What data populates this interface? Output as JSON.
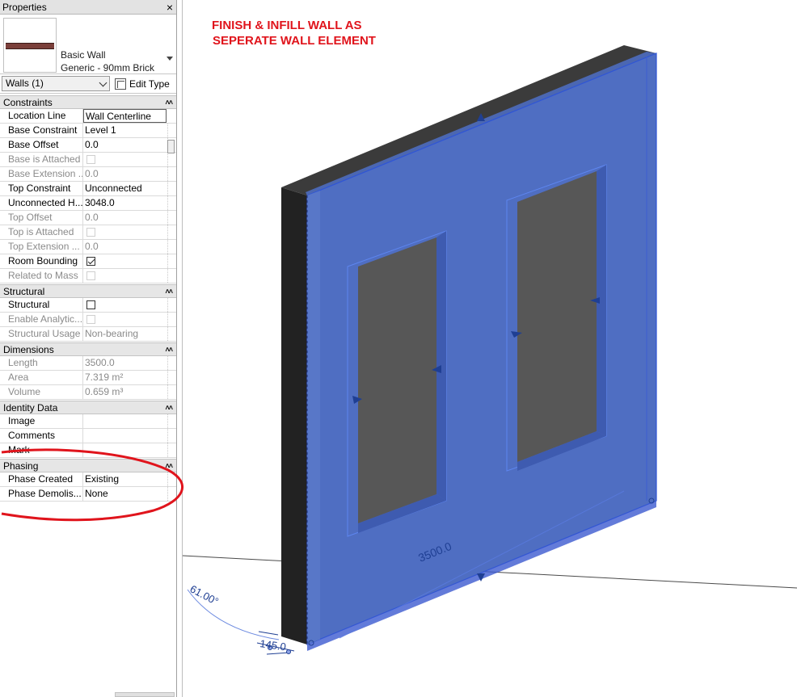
{
  "palette": {
    "title": "Properties",
    "close_glyph": "×",
    "type": {
      "family": "Basic Wall",
      "name": "Generic - 90mm Brick"
    },
    "filter": "Walls (1)",
    "edit_type": "Edit Type",
    "groups": [
      {
        "name": "Constraints",
        "rows": [
          {
            "name": "Location Line",
            "value": "Wall Centerline",
            "state": "editing"
          },
          {
            "name": "Base Constraint",
            "value": "Level 1",
            "state": "normal"
          },
          {
            "name": "Base Offset",
            "value": "0.0",
            "state": "normal"
          },
          {
            "name": "Base is Attached",
            "value": "",
            "state": "disabled",
            "checkbox": "off"
          },
          {
            "name": "Base Extension ...",
            "value": "0.0",
            "state": "disabled"
          },
          {
            "name": "Top Constraint",
            "value": "Unconnected",
            "state": "normal"
          },
          {
            "name": "Unconnected H...",
            "value": "3048.0",
            "state": "normal"
          },
          {
            "name": "Top Offset",
            "value": "0.0",
            "state": "disabled"
          },
          {
            "name": "Top is Attached",
            "value": "",
            "state": "disabled",
            "checkbox": "off"
          },
          {
            "name": "Top Extension ...",
            "value": "0.0",
            "state": "disabled"
          },
          {
            "name": "Room Bounding",
            "value": "",
            "state": "normal",
            "checkbox": "on"
          },
          {
            "name": "Related to Mass",
            "value": "",
            "state": "disabled",
            "checkbox": "off"
          }
        ]
      },
      {
        "name": "Structural",
        "rows": [
          {
            "name": "Structural",
            "value": "",
            "state": "normal",
            "checkbox": "empty"
          },
          {
            "name": "Enable Analytic...",
            "value": "",
            "state": "disabled",
            "checkbox": "off"
          },
          {
            "name": "Structural Usage",
            "value": "Non-bearing",
            "state": "disabled"
          }
        ]
      },
      {
        "name": "Dimensions",
        "rows": [
          {
            "name": "Length",
            "value": "3500.0",
            "state": "disabled"
          },
          {
            "name": "Area",
            "value": "7.319 m²",
            "state": "disabled"
          },
          {
            "name": "Volume",
            "value": "0.659 m³",
            "state": "disabled"
          }
        ]
      },
      {
        "name": "Identity Data",
        "rows": [
          {
            "name": "Image",
            "value": "",
            "state": "normal"
          },
          {
            "name": "Comments",
            "value": "",
            "state": "normal"
          },
          {
            "name": "Mark",
            "value": "",
            "state": "normal"
          }
        ]
      },
      {
        "name": "Phasing",
        "rows": [
          {
            "name": "Phase Created",
            "value": "Existing",
            "state": "normal"
          },
          {
            "name": "Phase Demolis...",
            "value": "None",
            "state": "normal"
          }
        ]
      }
    ]
  },
  "viewport": {
    "annotation_line1": "FINISH & INFILL WALL AS",
    "annotation_line2": "SEPERATE WALL ELEMENT",
    "dimension_length": "3500.0",
    "dimension_angle": "61.00°",
    "dimension_thickness": "145.0"
  },
  "colors": {
    "annotation_red": "#e0141c",
    "wall_blue": "#4e6dc0",
    "wall_edge": "#2f55d6",
    "dark_face": "#2b2b2b",
    "opening_gray": "#595959",
    "dimension_blue": "#1f3f93"
  }
}
